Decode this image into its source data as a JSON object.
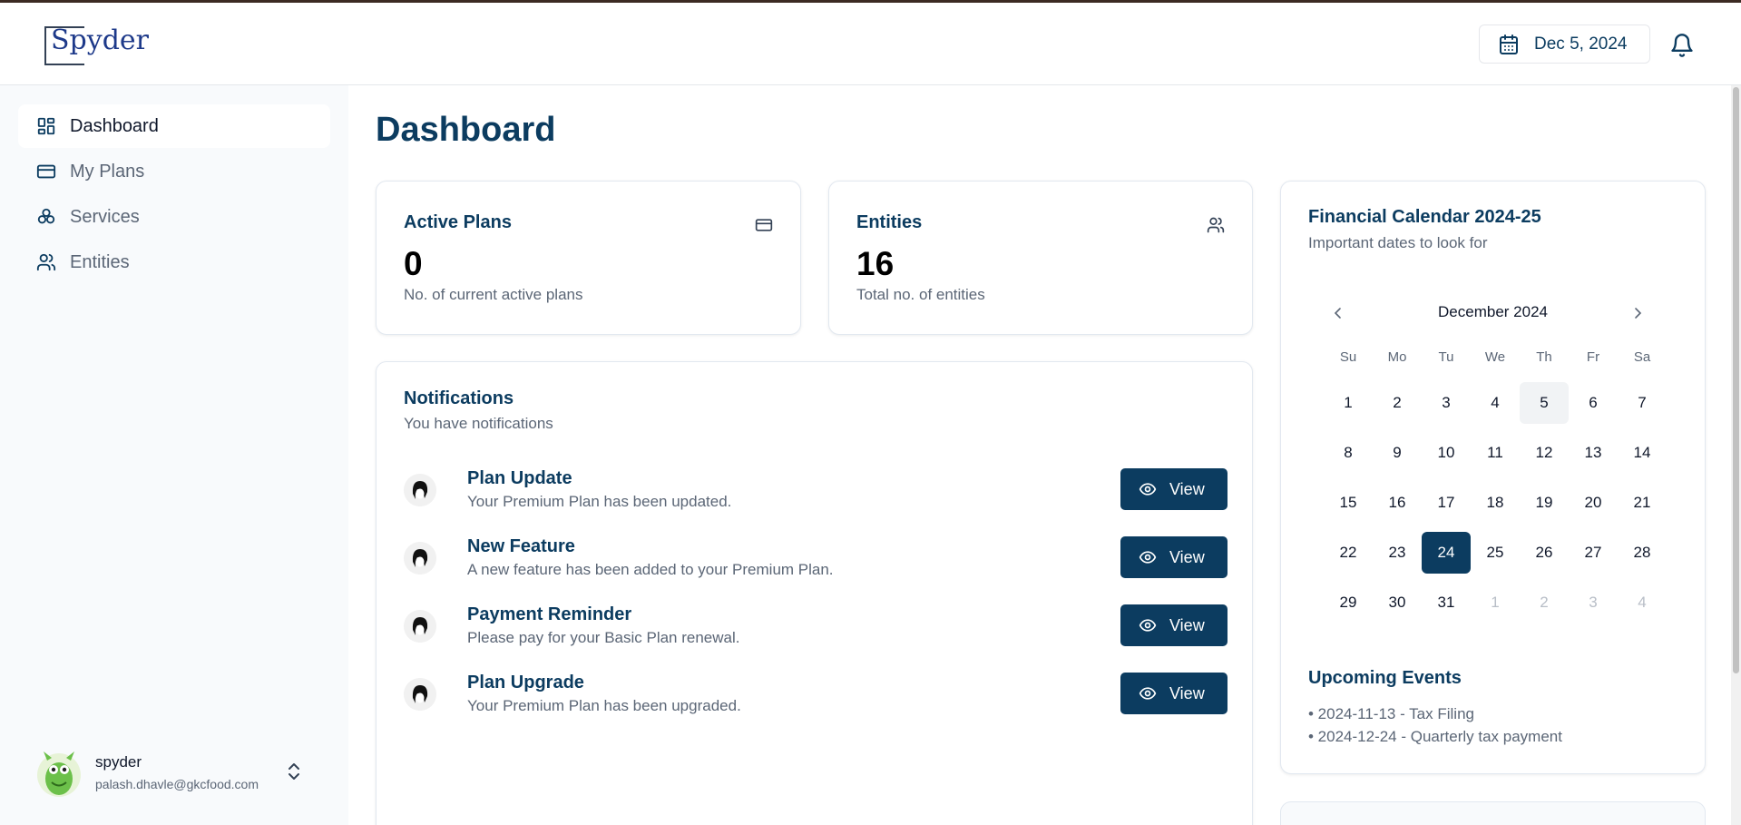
{
  "app": {
    "logo_text": "Spyder"
  },
  "header": {
    "date": "Dec 5, 2024"
  },
  "sidebar": {
    "items": [
      {
        "label": "Dashboard",
        "icon": "layout-dashboard-icon",
        "active": true
      },
      {
        "label": "My Plans",
        "icon": "credit-card-icon",
        "active": false
      },
      {
        "label": "Services",
        "icon": "services-icon",
        "active": false
      },
      {
        "label": "Entities",
        "icon": "users-icon",
        "active": false
      }
    ],
    "user": {
      "name": "spyder",
      "email": "palash.dhavle@gkcfood.com"
    }
  },
  "main": {
    "title": "Dashboard",
    "stats": [
      {
        "title": "Active Plans",
        "value": "0",
        "desc": "No. of current active plans",
        "icon": "credit-card-icon"
      },
      {
        "title": "Entities",
        "value": "16",
        "desc": "Total no. of entities",
        "icon": "users-icon"
      }
    ],
    "notifications": {
      "title": "Notifications",
      "subtitle": "You have notifications",
      "view_label": "View",
      "items": [
        {
          "title": "Plan Update",
          "desc": "Your Premium Plan has been updated."
        },
        {
          "title": "New Feature",
          "desc": "A new feature has been added to your Premium Plan."
        },
        {
          "title": "Payment Reminder",
          "desc": "Please pay for your Basic Plan renewal."
        },
        {
          "title": "Plan Upgrade",
          "desc": "Your Premium Plan has been upgraded."
        }
      ]
    },
    "calendar": {
      "title": "Financial Calendar 2024-25",
      "subtitle": "Important dates to look for",
      "month": "December 2024",
      "weekdays": [
        "Su",
        "Mo",
        "Tu",
        "We",
        "Th",
        "Fr",
        "Sa"
      ],
      "weeks": [
        [
          "1",
          "2",
          "3",
          "4",
          "5",
          "6",
          "7"
        ],
        [
          "8",
          "9",
          "10",
          "11",
          "12",
          "13",
          "14"
        ],
        [
          "15",
          "16",
          "17",
          "18",
          "19",
          "20",
          "21"
        ],
        [
          "22",
          "23",
          "24",
          "25",
          "26",
          "27",
          "28"
        ],
        [
          "29",
          "30",
          "31",
          "1",
          "2",
          "3",
          "4"
        ]
      ],
      "today": "5",
      "selected": "24",
      "events_title": "Upcoming Events",
      "events": [
        "• 2024-11-13 - Tax Filing",
        "• 2024-12-24 - Quarterly tax payment"
      ]
    }
  },
  "colors": {
    "primary": "#0c3c60",
    "muted": "#5b6676",
    "sidebar_bg": "#f8fafc"
  }
}
